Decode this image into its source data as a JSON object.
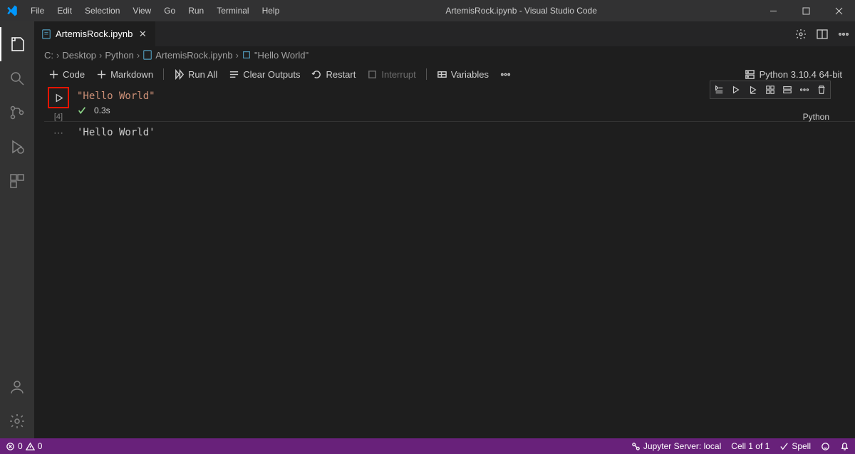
{
  "window_title": "ArtemisRock.ipynb - Visual Studio Code",
  "menu": [
    "File",
    "Edit",
    "Selection",
    "View",
    "Go",
    "Run",
    "Terminal",
    "Help"
  ],
  "tab": {
    "label": "ArtemisRock.ipynb"
  },
  "breadcrumb": {
    "p0": "C:",
    "p1": "Desktop",
    "p2": "Python",
    "p3": "ArtemisRock.ipynb",
    "p4": "\"Hello World\""
  },
  "toolbar": {
    "code": "Code",
    "markdown": "Markdown",
    "run_all": "Run All",
    "clear": "Clear Outputs",
    "restart": "Restart",
    "interrupt": "Interrupt",
    "variables": "Variables",
    "kernel": "Python 3.10.4 64-bit"
  },
  "cell": {
    "code": "\"Hello World\"",
    "exec_count": "[4]",
    "duration": "0.3s",
    "language": "Python",
    "output": "'Hello World'"
  },
  "status": {
    "errors": "0",
    "warnings": "0",
    "jupyter": "Jupyter Server: local",
    "cell_count": "Cell 1 of 1",
    "spell": "Spell"
  }
}
